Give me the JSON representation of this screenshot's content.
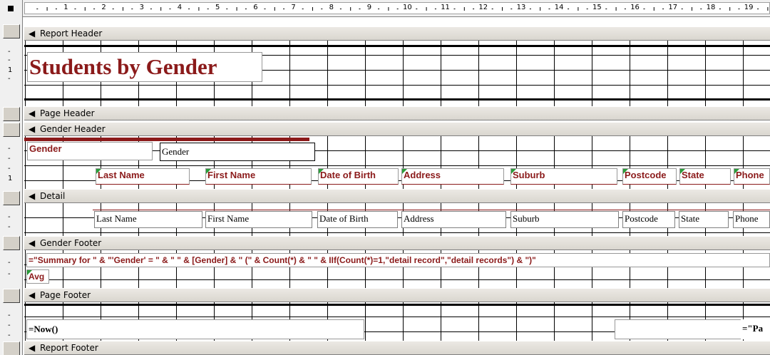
{
  "ruler": {
    "numbers": [
      "1",
      "2",
      "3",
      "4",
      "5",
      "6",
      "7",
      "8",
      "9",
      "10",
      "11",
      "12",
      "13",
      "14",
      "15",
      "16",
      "17",
      "18",
      "19"
    ]
  },
  "gutter": {
    "vertical_marks": [
      "1",
      "1"
    ]
  },
  "sections": {
    "report_header": "Report Header",
    "page_header": "Page Header",
    "gender_header": "Gender Header",
    "detail": "Detail",
    "gender_footer": "Gender Footer",
    "page_footer": "Page Footer",
    "report_footer": "Report Footer"
  },
  "report_header": {
    "title": "Students by Gender"
  },
  "gender_header": {
    "gender_label": "Gender",
    "gender_field": "Gender",
    "column_labels": [
      "Last Name",
      "First Name",
      "Date of Birth",
      "Address",
      "Suburb",
      "Postcode",
      "State",
      "Phone"
    ]
  },
  "detail": {
    "fields": [
      "Last Name",
      "First Name",
      "Date of Birth",
      "Address",
      "Suburb",
      "Postcode",
      "State",
      "Phone"
    ]
  },
  "gender_footer": {
    "summary_expression": "=\"Summary for \" & \"'Gender' = \" & \" \" & [Gender] & \" (\" & Count(*) & \" \" & IIf(Count(*)=1,\"detail record\",\"detail records\") & \")\"",
    "avg_label": "Avg"
  },
  "page_footer": {
    "now_expression": "=Now()",
    "page_expression": "=\"Pa"
  },
  "colors": {
    "label_text": "#8b1a1a",
    "grid_line": "#000000",
    "section_bar": "#d9d6cf",
    "flag": "#2a9d3a"
  }
}
